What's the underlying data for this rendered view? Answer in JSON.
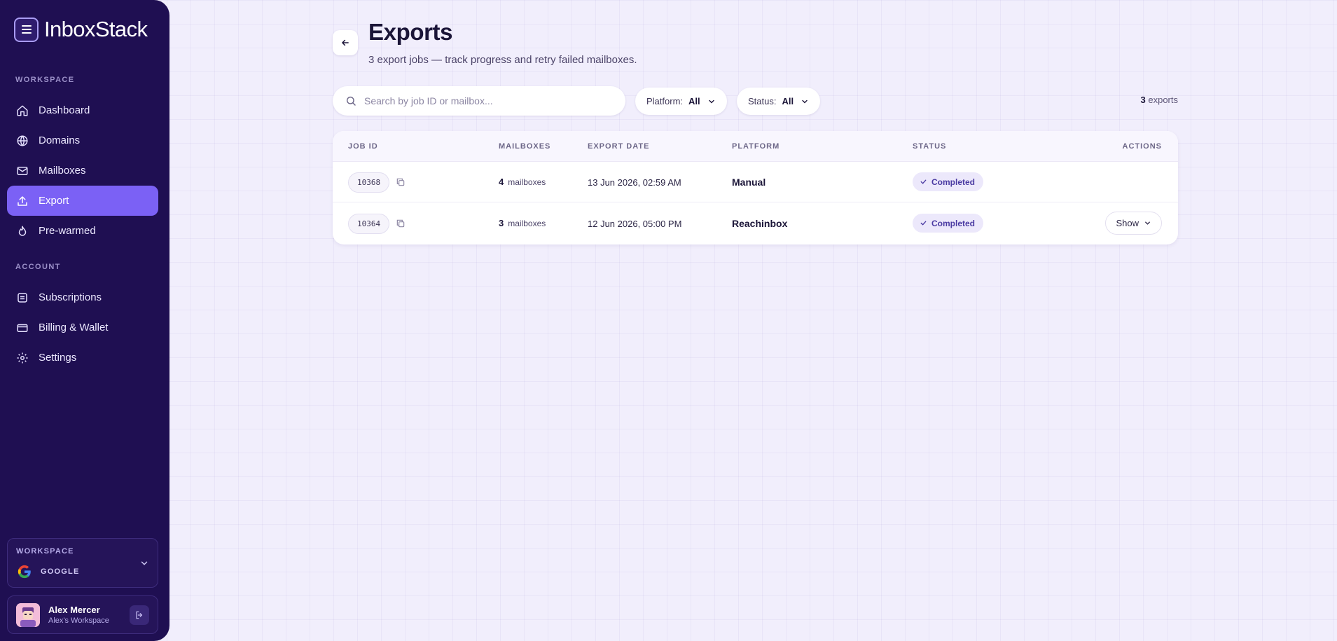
{
  "app": {
    "name": "InboxStack"
  },
  "sidebar": {
    "workspace_label": "WORKSPACE",
    "account_label": "ACCOUNT",
    "workspace_items": [
      {
        "label": "Dashboard",
        "icon": "home-icon"
      },
      {
        "label": "Domains",
        "icon": "globe-icon"
      },
      {
        "label": "Mailboxes",
        "icon": "mail-icon"
      },
      {
        "label": "Export",
        "icon": "upload-icon",
        "active": true
      },
      {
        "label": "Pre-warmed",
        "icon": "flame-icon"
      }
    ],
    "account_items": [
      {
        "label": "Subscriptions",
        "icon": "list-icon"
      },
      {
        "label": "Billing & Wallet",
        "icon": "card-icon"
      },
      {
        "label": "Settings",
        "icon": "gear-icon"
      }
    ],
    "workspace_switcher": {
      "label": "WORKSPACE",
      "name": "GOOGLE"
    },
    "user": {
      "name": "Alex Mercer",
      "workspace": "Alex's Workspace"
    }
  },
  "header": {
    "title": "Exports",
    "subtitle": "3 export jobs — track progress and retry failed mailboxes."
  },
  "toolbar": {
    "search_placeholder": "Search by job ID or mailbox...",
    "platform_filter": {
      "label": "Platform:",
      "value": "All"
    },
    "status_filter": {
      "label": "Status:",
      "value": "All"
    },
    "count_number": "3",
    "count_label": "exports"
  },
  "table": {
    "columns": [
      "JOB ID",
      "MAILBOXES",
      "EXPORT DATE",
      "PLATFORM",
      "STATUS",
      "ACTIONS"
    ],
    "rows": [
      {
        "job_id": "10368",
        "mailbox_count": "4",
        "mailbox_word": "mailboxes",
        "export_date": "13 Jun 2026, 02:59 AM",
        "platform": "Manual",
        "status": "Completed"
      },
      {
        "job_id": "10364",
        "mailbox_count": "3",
        "mailbox_word": "mailboxes",
        "export_date": "12 Jun 2026, 05:00 PM",
        "platform": "Reachinbox",
        "status": "Completed",
        "action": "Show"
      }
    ]
  },
  "colors": {
    "sidebar_bg": "#1f0f52",
    "accent": "#7b61f5",
    "badge_bg": "#ece8fb",
    "badge_text": "#4a3aa2"
  }
}
